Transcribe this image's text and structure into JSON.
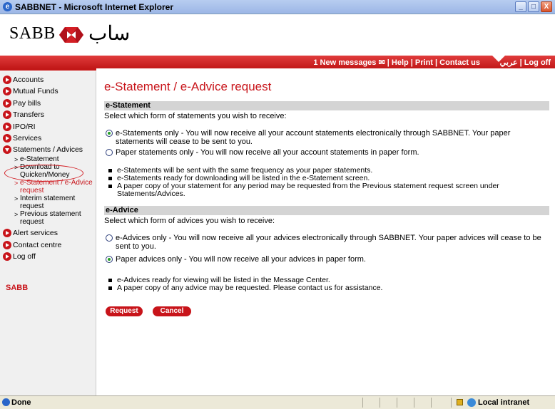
{
  "window": {
    "title": "SABBNET - Microsoft Internet Explorer",
    "ie_icon": "e",
    "minimize": "_",
    "maximize": "□",
    "close": "X"
  },
  "logo": {
    "text": "SABB",
    "arabic": "ساب"
  },
  "topnav": {
    "messages": "1 New messages ✉",
    "links": " | Help | Print | Contact us",
    "right": "عربي | Log off"
  },
  "sidebar": {
    "items": [
      {
        "label": "Accounts"
      },
      {
        "label": "Mutual Funds"
      },
      {
        "label": "Pay bills"
      },
      {
        "label": "Transfers"
      },
      {
        "label": "IPO/RI"
      },
      {
        "label": "Services"
      },
      {
        "label": "Statements / Advices"
      }
    ],
    "subitems": [
      {
        "label": "e-Statement"
      },
      {
        "label": "Download to Quicken/Money"
      },
      {
        "label": "e-Statement / e-Advice request"
      },
      {
        "label": "Interim statement request"
      },
      {
        "label": "Previous statement request"
      }
    ],
    "items_after": [
      {
        "label": "Alert services"
      },
      {
        "label": "Contact centre"
      },
      {
        "label": "Log off"
      }
    ],
    "brand": "SABB"
  },
  "main": {
    "title": "e-Statement / e-Advice request",
    "estatement": {
      "header": "e-Statement",
      "prompt": "Select which form of statements you wish to receive:",
      "option1": "e-Statements only - You will now receive all your account statements electronically through SABBNET. Your paper statements will cease to be sent to you.",
      "option2": "Paper statements only - You will now receive all your account statements in paper form.",
      "notes": [
        "e-Statements will be sent with the same frequency as your paper statements.",
        "e-Statements ready for downloading will be listed in the e-Statement screen.",
        "A paper copy of your statement for any period may be requested from the Previous statement request screen under Statements/Advices."
      ]
    },
    "eadvice": {
      "header": "e-Advice",
      "prompt": "Select which form of advices you wish to receive:",
      "option1": "e-Advices only - You will now receive all your advices electronically through SABBNET. Your paper advices will cease to be sent to you.",
      "option2": "Paper advices only - You will now receive all your advices in paper form.",
      "notes": [
        "e-Advices ready for viewing will be listed in the Message Center.",
        "A paper copy of any advice may be requested. Please contact us for assistance."
      ]
    },
    "buttons": {
      "request": "Request",
      "cancel": "Cancel"
    }
  },
  "status": {
    "left": "Done",
    "zone": "Local intranet"
  },
  "colors": {
    "brand_red": "#c8141a",
    "nav_red": "#d42525",
    "section_gray": "#d4d4d4"
  }
}
